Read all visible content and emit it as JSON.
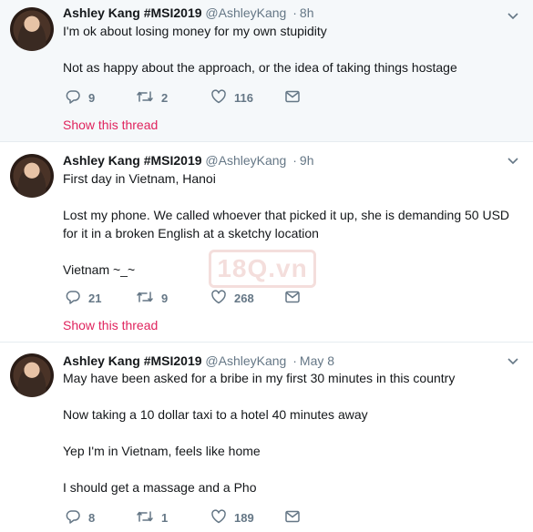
{
  "tweets": [
    {
      "name": "Ashley Kang #MSI2019",
      "handle": "@AshleyKang",
      "time": "8h",
      "lines": [
        "I'm ok about losing money for my own stupidity",
        "Not as happy about the approach, or the idea of taking things hostage"
      ],
      "replies": "9",
      "retweets": "2",
      "likes": "116",
      "thread_label": "Show this thread"
    },
    {
      "name": "Ashley Kang #MSI2019",
      "handle": "@AshleyKang",
      "time": "9h",
      "lines": [
        "First day in Vietnam, Hanoi",
        "Lost my phone. We called whoever that picked it up, she is demanding 50 USD for it in a broken English at a sketchy location",
        "Vietnam ~_~"
      ],
      "replies": "21",
      "retweets": "9",
      "likes": "268",
      "thread_label": "Show this thread"
    },
    {
      "name": "Ashley Kang #MSI2019",
      "handle": "@AshleyKang",
      "time": "May 8",
      "lines": [
        "May have been asked for a bribe in my first 30 minutes in this country",
        "Now taking a 10 dollar taxi to a hotel 40 minutes away",
        "Yep I'm in Vietnam, feels like home",
        "I should get a massage and a Pho"
      ],
      "replies": "8",
      "retweets": "1",
      "likes": "189"
    }
  ],
  "separator": "·",
  "watermark": "18Q.vn",
  "colors": {
    "accent_link": "#e0245e",
    "muted": "#657786",
    "text": "#14171a",
    "highlight_bg": "#f5f8fa",
    "border": "#e6ecf0"
  },
  "icons": [
    "reply-icon",
    "retweet-icon",
    "like-icon",
    "direct-message-icon",
    "chevron-down-icon"
  ]
}
